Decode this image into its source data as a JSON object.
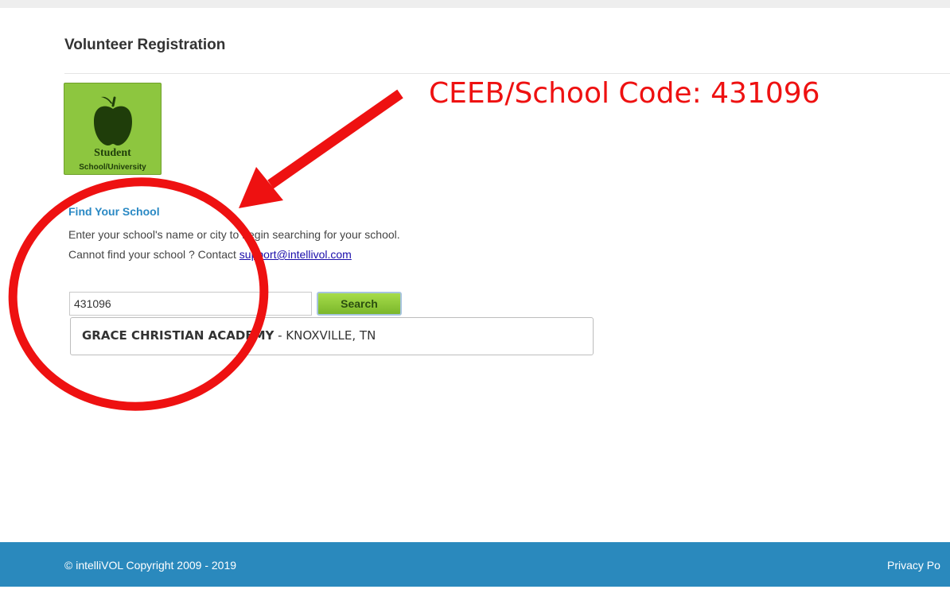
{
  "page": {
    "title": "Volunteer Registration"
  },
  "student_tile": {
    "title": "Student",
    "subtitle": "School/University"
  },
  "find_school": {
    "heading": "Find Your School",
    "line1": "Enter your school's name or city to begin searching for your school.",
    "line2_prefix": "Cannot find your school ? Contact ",
    "support_email": "support@intellivol.com"
  },
  "search": {
    "value": "431096",
    "button_label": "Search"
  },
  "results": [
    {
      "name": "GRACE CHRISTIAN ACADEMY",
      "location": " - KNOXVILLE, TN"
    }
  ],
  "annotation": {
    "text": "CEEB/School Code: 431096",
    "color": "#ee1111"
  },
  "footer": {
    "copyright": "© intelliVOL Copyright 2009 - 2019",
    "privacy": "Privacy Po"
  },
  "colors": {
    "accent": "#2a89bd",
    "tile_green": "#8dc63f",
    "heading_blue": "#2a89c4"
  },
  "icons": {
    "tile": "apple-icon"
  }
}
